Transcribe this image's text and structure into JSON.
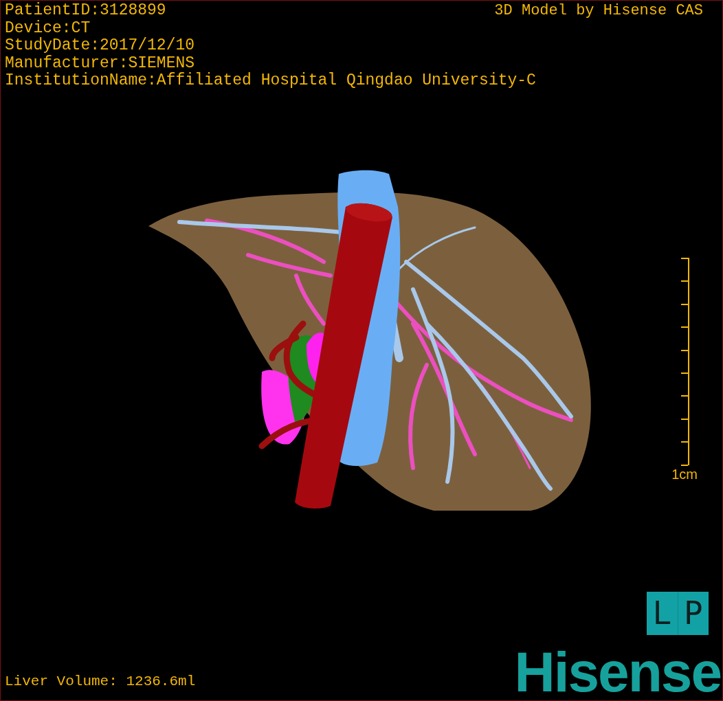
{
  "info_lines": [
    "PatientID:3128899",
    "Device:CT",
    "StudyDate:2017/12/10",
    "Manufacturer:SIEMENS",
    "InstitutionName:Affiliated Hospital Qingdao University-C"
  ],
  "title": "3D Model by Hisense CAS",
  "scale_bar": {
    "label": "1cm"
  },
  "orientation_marker": [
    "L",
    "P"
  ],
  "liver_volume": "Liver Volume: 1236.6ml",
  "logo": "Hisense"
}
